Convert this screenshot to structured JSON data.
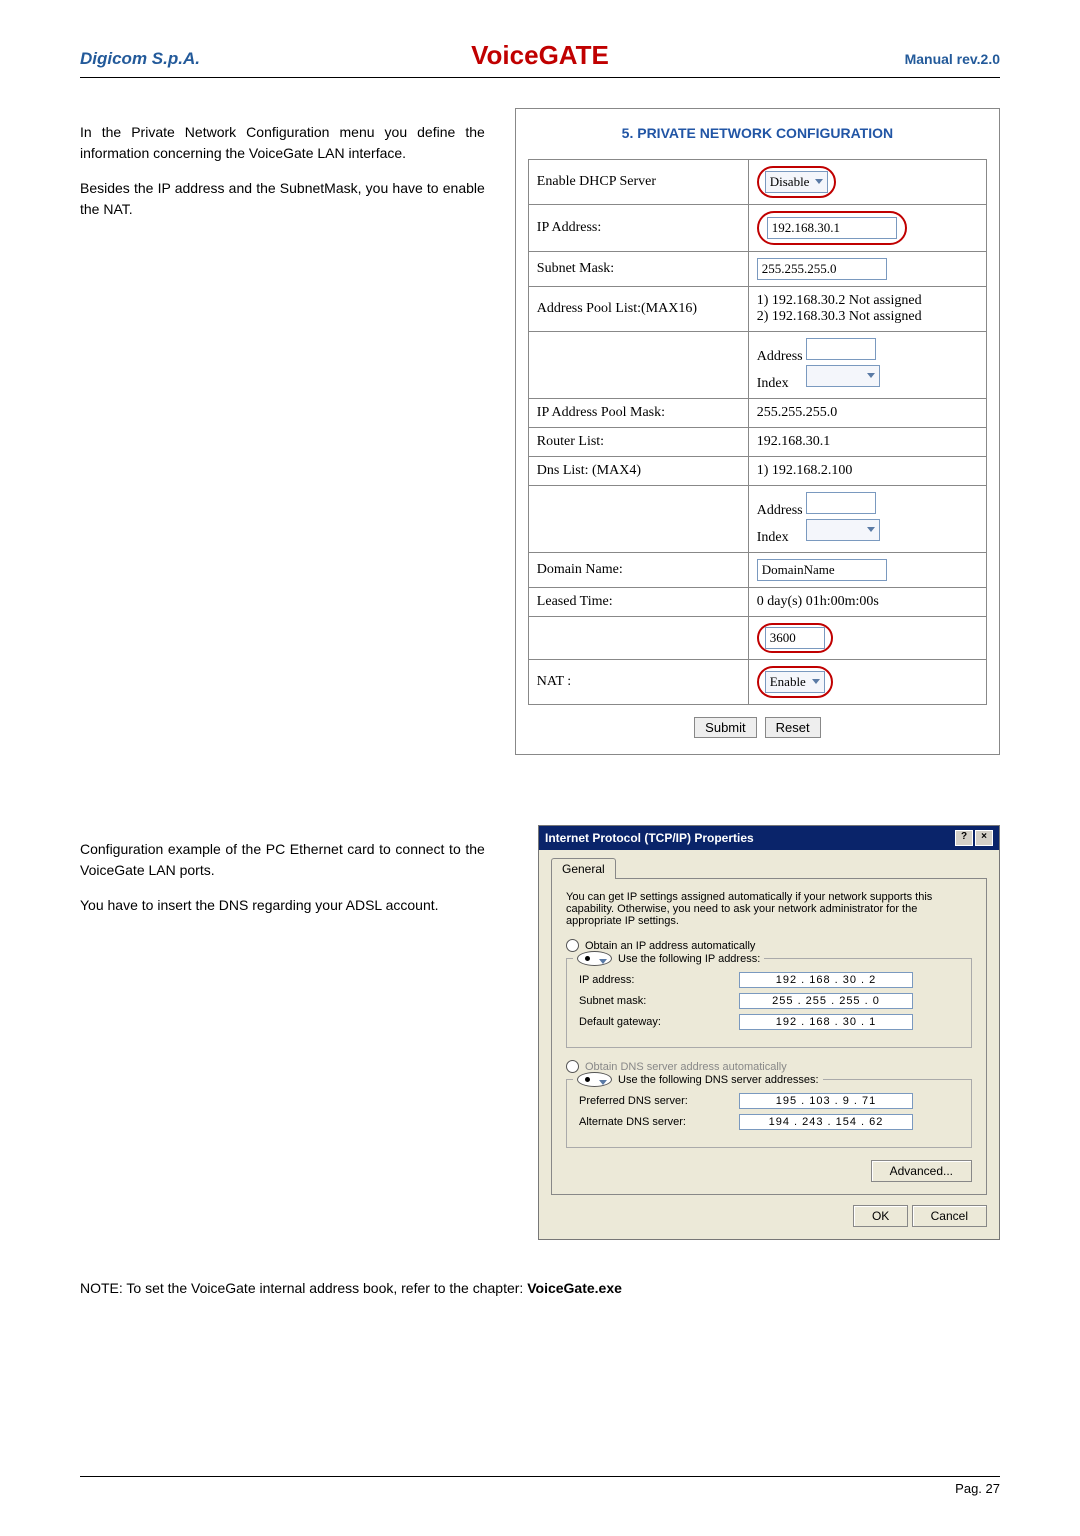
{
  "header": {
    "brand": "Digicom S.p.A.",
    "product": "VoiceGATE",
    "revision": "Manual rev.2.0"
  },
  "sections": {
    "private_network": {
      "left_text_1": "In the Private Network Configuration menu you define the information concerning the VoiceGate LAN interface.",
      "left_text_2": "Besides the IP address and the SubnetMask, you have to enable the NAT.",
      "panel_title": "5. PRIVATE NETWORK CONFIGURATION",
      "rows": {
        "enable_dhcp": {
          "label": "Enable DHCP Server",
          "value": "Disable"
        },
        "ip_address": {
          "label": "IP Address:",
          "value": "192.168.30.1"
        },
        "subnet": {
          "label": "Subnet Mask:",
          "value": "255.255.255.0"
        },
        "pool_list": {
          "label": "Address Pool List:(MAX16)",
          "line1": "1) 192.168.30.2 Not assigned",
          "line2": "2) 192.168.30.3 Not assigned"
        },
        "addr_idx1": {
          "addr_label": "Address",
          "idx_label": "Index"
        },
        "pool_mask": {
          "label": "IP Address Pool Mask:",
          "value": "255.255.255.0"
        },
        "router_list": {
          "label": "Router List:",
          "value": "192.168.30.1"
        },
        "dns_list": {
          "label": "Dns List: (MAX4)",
          "value": "1) 192.168.2.100"
        },
        "addr_idx2": {
          "addr_label": "Address",
          "idx_label": "Index"
        },
        "domain": {
          "label": "Domain Name:",
          "value": "DomainName"
        },
        "leased": {
          "label": "Leased Time:",
          "value": "0 day(s) 01h:00m:00s"
        },
        "leased_num": {
          "value": "3600"
        },
        "nat": {
          "label": "NAT :",
          "value": "Enable"
        }
      },
      "buttons": {
        "submit": "Submit",
        "reset": "Reset"
      }
    },
    "tcpip": {
      "left_text_1": "Configuration example of the  PC Ethernet card to connect to the VoiceGate LAN ports.",
      "left_text_2": "You have to insert the DNS regarding your ADSL account.",
      "dialog": {
        "title": "Internet Protocol (TCP/IP) Properties",
        "tab": "General",
        "desc": "You can get IP settings assigned automatically if your network supports this capability. Otherwise, you need to ask your network administrator for the appropriate IP settings.",
        "radio_auto_ip": "Obtain an IP address automatically",
        "radio_use_ip": "Use the following IP address:",
        "ip_addr": {
          "label": "IP address:",
          "value": "192 . 168 .  30  .   2"
        },
        "subnet": {
          "label": "Subnet mask:",
          "value": "255 . 255 . 255 .   0"
        },
        "gateway": {
          "label": "Default gateway:",
          "value": "192 . 168 .  30  .   1"
        },
        "radio_auto_dns": "Obtain DNS server address automatically",
        "radio_use_dns": "Use the following DNS server addresses:",
        "dns_pref": {
          "label": "Preferred DNS server:",
          "value": "195 . 103 .   9  .  71"
        },
        "dns_alt": {
          "label": "Alternate DNS server:",
          "value": "194 . 243 . 154 .  62"
        },
        "advanced": "Advanced...",
        "ok": "OK",
        "cancel": "Cancel"
      }
    }
  },
  "note": {
    "prefix": "NOTE: To set the VoiceGate internal address book, refer to the chapter: ",
    "bold": "VoiceGate.exe"
  },
  "footer": {
    "page": "Pag. 27"
  }
}
